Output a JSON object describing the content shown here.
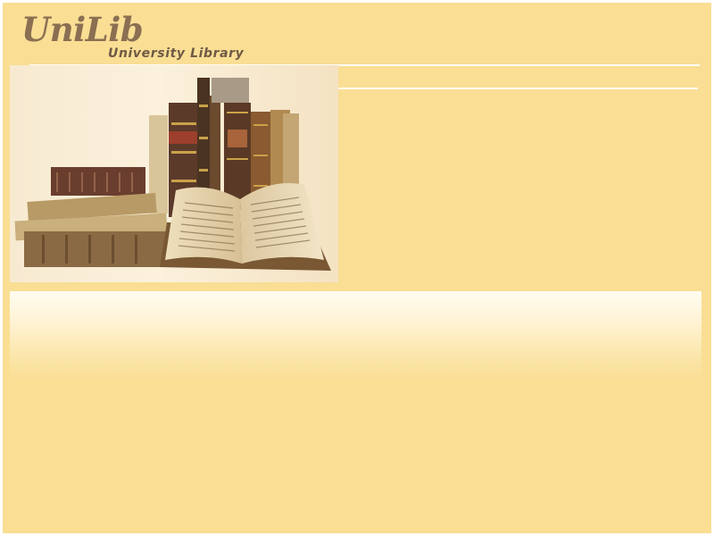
{
  "header": {
    "logo_text": "UniLib",
    "subtitle": "University Library"
  },
  "hero": {
    "image": "antique-books-photo"
  },
  "colors": {
    "page_background": "#f9de94",
    "frame_border": "#ffffff",
    "logo_text": "#8a6f52",
    "subtitle_text": "#6f5a46",
    "rule": "#fffdf4",
    "fade_band_top": "#fffcf0"
  }
}
